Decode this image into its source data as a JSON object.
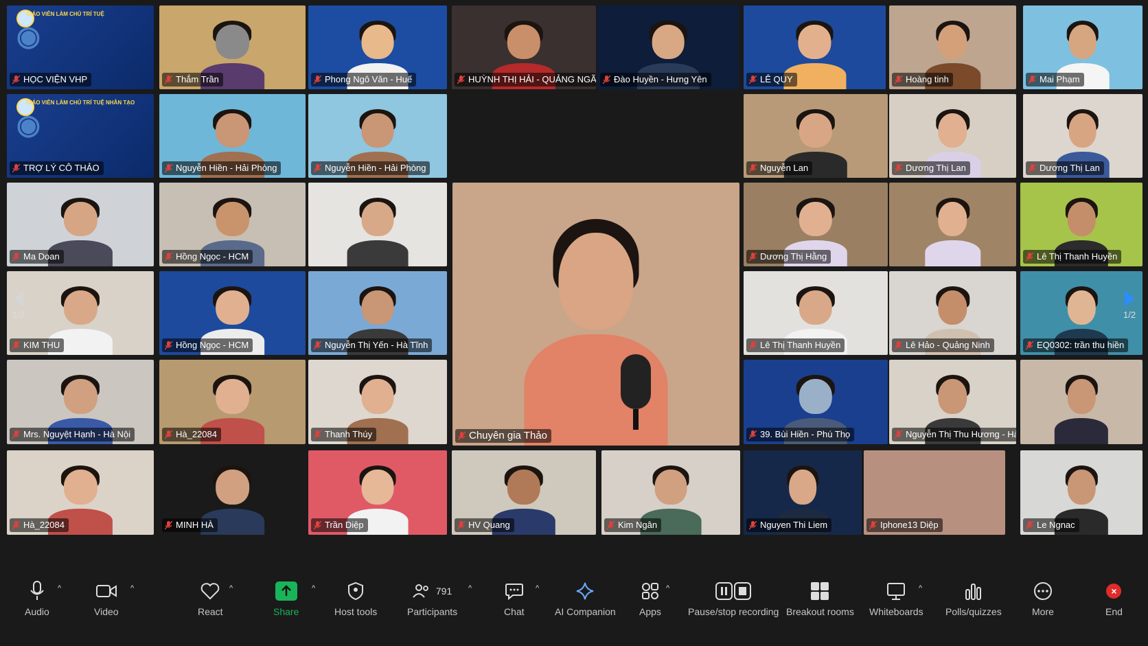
{
  "meeting": {
    "page_indicator": "1/2"
  },
  "featured": {
    "name": "Chuyên gia Thảo"
  },
  "tiles": [
    {
      "name": "HỌC VIỆN VHP",
      "bg": "#1a3f8f",
      "type": "ai",
      "ai_text": "GIÁO VIÊN LÀM CHỦ TRÍ TUỆ"
    },
    {
      "name": "Thắm Trần",
      "bg": "#c9a66b",
      "type": "person",
      "skin": "#8a8a8a",
      "shirt": "#5a3b6e"
    },
    {
      "name": "Phong Ngô Văn - Huế",
      "bg": "#1c4da3",
      "type": "person",
      "skin": "#e8b98a",
      "shirt": "#f2f2f2"
    },
    {
      "name": "HUỲNH THỊ HẢI - QUẢNG NGÃI",
      "bg": "#3a3030",
      "type": "person",
      "skin": "#c98f6a",
      "shirt": "#b52a2a"
    },
    {
      "name": "Đào Huyền - Hưng Yên",
      "bg": "#0d1d3a",
      "type": "person",
      "skin": "#d8a885",
      "shirt": "#2a3b5a"
    },
    {
      "name": "LÊ QUY",
      "bg": "#1d4a9c",
      "type": "person",
      "skin": "#e3b08d",
      "shirt": "#f0b060"
    },
    {
      "name": "Hoàng tinh",
      "bg": "#bda58f",
      "type": "person",
      "skin": "#d4a07a",
      "shirt": "#7a4a2a"
    },
    {
      "name": "Mai Phạm",
      "bg": "#7ec0e0",
      "type": "person",
      "skin": "#d6a680",
      "shirt": "#f5f5f5"
    },
    {
      "name": "TRỢ LÝ CÔ THẢO",
      "bg": "#1a3f8f",
      "type": "ai",
      "ai_text": "GIÁO VIÊN LÀM CHỦ TRÍ TUỆ NHÂN TẠO"
    },
    {
      "name": "Nguyễn Hiền - Hải Phòng",
      "bg": "#6fb7d8",
      "type": "person",
      "skin": "#c99676",
      "shirt": "#a07050"
    },
    {
      "name": "Nguyễn Hiền - Hải Phòng",
      "bg": "#8fc6e0",
      "type": "person",
      "skin": "#c99676",
      "shirt": "#a07050"
    },
    {
      "name": "Nguyễn Lan",
      "bg": "#b89a78",
      "type": "person",
      "skin": "#d9a685",
      "shirt": "#2a2a2a"
    },
    {
      "name": "Dương Thị Lan",
      "bg": "#d8cfc4",
      "type": "person",
      "skin": "#e0b090",
      "shirt": "#d9d0e8"
    },
    {
      "name": "Dương Thị Lan",
      "bg": "#dcd6ce",
      "type": "person",
      "skin": "#d8a583",
      "shirt": "#3a5a9a"
    },
    {
      "name": "Ma Doan",
      "bg": "#cfd3d8",
      "type": "person",
      "skin": "#d6a584",
      "shirt": "#4a4a5a"
    },
    {
      "name": "Hồng Ngọc - HCM",
      "bg": "#c8bfb4",
      "type": "person",
      "skin": "#c9946c",
      "shirt": "#5a6a8a"
    },
    {
      "name": "",
      "bg": "#e6e4e1",
      "type": "person",
      "skin": "#d8a988",
      "shirt": "#3a3a3a"
    },
    {
      "name": "Dương Thị Hằng",
      "bg": "#9a7f63",
      "type": "person",
      "skin": "#e0b090",
      "shirt": "#e0d6ec"
    },
    {
      "name": "",
      "bg": "#a08466",
      "type": "person",
      "skin": "#e0b090",
      "shirt": "#e0d6ec"
    },
    {
      "name": "Lê Thị Thanh Huyền",
      "bg": "#a6c44a",
      "type": "person",
      "skin": "#c48e6a",
      "shirt": "#2c2c2c"
    },
    {
      "name": "KIM THU",
      "bg": "#d8d2c8",
      "type": "person",
      "skin": "#d8a888",
      "shirt": "#f2f2f2"
    },
    {
      "name": "Hồng Ngọc - HCM",
      "bg": "#1d4a9c",
      "type": "person",
      "skin": "#e0b090",
      "shirt": "#ececec"
    },
    {
      "name": "Nguyễn Thị Yến - Hà Tĩnh",
      "bg": "#7aa9d6",
      "type": "person",
      "skin": "#c99676",
      "shirt": "#3a3a3a"
    },
    {
      "name": "Lê Thị Thanh Huyền",
      "bg": "#e3e1de",
      "type": "person",
      "skin": "#d8a888",
      "shirt": "#f2f2f2"
    },
    {
      "name": "Lê Hảo - Quảng Ninh",
      "bg": "#d9d5d0",
      "type": "person",
      "skin": "#c48e6a",
      "shirt": "#d0c0b0"
    },
    {
      "name": "EQ0302: trần thu hiền",
      "bg": "#3f8fa8",
      "type": "person",
      "skin": "#e0b594",
      "shirt": "#1e3a50"
    },
    {
      "name": "Mrs. Nguyệt Hạnh - Hà Nội",
      "bg": "#cbc6c0",
      "type": "person",
      "skin": "#d0a080",
      "shirt": "#3a5aa8"
    },
    {
      "name": "Hà_22084",
      "bg": "#b89a70",
      "type": "person",
      "skin": "#e0b090",
      "shirt": "#c0504a"
    },
    {
      "name": "Thanh Thúy",
      "bg": "#ddd7cf",
      "type": "person",
      "skin": "#e0b090",
      "shirt": "#a07050"
    },
    {
      "name": "39. Bùi Hiền - Phú Thọ",
      "bg": "#1a3f8f",
      "type": "person",
      "skin": "#9ab0c8",
      "shirt": "#4a5a7a"
    },
    {
      "name": "Nguyễn Thị Thu Hương - Hà Nam",
      "bg": "#d8d2c8",
      "type": "person",
      "skin": "#c99676",
      "shirt": "#3a3a3a"
    },
    {
      "name": "",
      "bg": "#c8b8a8",
      "type": "person",
      "skin": "#c99676",
      "shirt": "#2a2a3a"
    },
    {
      "name": "Hà_22084",
      "bg": "#dcd3c8",
      "type": "person",
      "skin": "#e0b090",
      "shirt": "#c0504a"
    },
    {
      "name": "MINH HÀ",
      "bg": "#1a1a1a",
      "type": "person",
      "skin": "#d0a080",
      "shirt": "#2a3a5a"
    },
    {
      "name": "Trần Diệp",
      "bg": "#e05a66",
      "type": "person",
      "skin": "#e6b898",
      "shirt": "#f2f2f2"
    },
    {
      "name": "HV Quang",
      "bg": "#cfc8bd",
      "type": "person",
      "skin": "#b07a58",
      "shirt": "#2a3a6a"
    },
    {
      "name": "Kim Ngân",
      "bg": "#d6d0c8",
      "type": "person",
      "skin": "#d0a080",
      "shirt": "#4a6a5a"
    },
    {
      "name": "Nguyen Thi Liem",
      "bg": "#16284a",
      "type": "person",
      "skin": "#d8a888",
      "shirt": "#1e2a40"
    },
    {
      "name": "Iphone13 Diệp",
      "bg": "#b89080",
      "type": "empty"
    },
    {
      "name": "Le Ngnac",
      "bg": "#d8d8d6",
      "type": "person",
      "skin": "#c99676",
      "shirt": "#2a2a2a"
    }
  ],
  "toolbar": {
    "audio": "Audio",
    "video": "Video",
    "react": "React",
    "share": "Share",
    "host_tools": "Host tools",
    "participants": "Participants",
    "participants_count": "791",
    "chat": "Chat",
    "ai_companion": "AI Companion",
    "apps": "Apps",
    "recording": "Pause/stop recording",
    "breakout": "Breakout rooms",
    "whiteboards": "Whiteboards",
    "polls": "Polls/quizzes",
    "more": "More",
    "end": "End"
  },
  "colors": {
    "share_green": "#19b35a",
    "end_red": "#e02b2b",
    "mic_muted": "#e0413b",
    "arrow_blue": "#2d8cff"
  }
}
